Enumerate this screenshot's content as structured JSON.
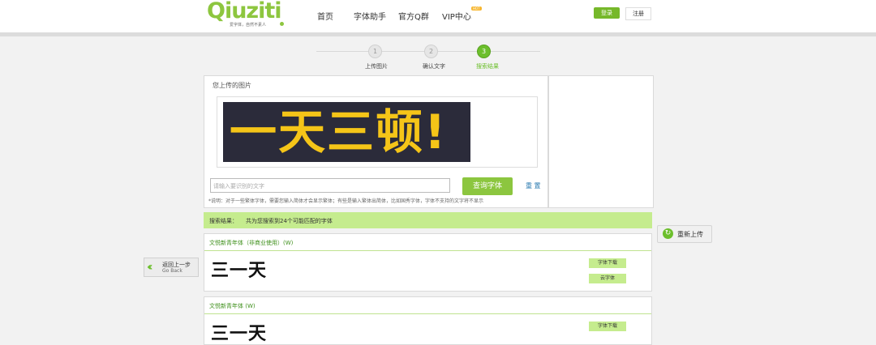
{
  "header": {
    "logo_text": "Qiuziti",
    "logo_slogan": "爱字体，自然不素人",
    "nav": [
      "首页",
      "字体助手",
      "官方Q群",
      "VIP中心"
    ],
    "vip_badge": "HOT",
    "login_label": "登录",
    "register_label": "注册"
  },
  "steps": [
    {
      "number": "1",
      "label": "上传图片"
    },
    {
      "number": "2",
      "label": "确认文字"
    },
    {
      "number": "3",
      "label": "搜索结果",
      "active": true
    }
  ],
  "upload": {
    "title": "您上传的图片",
    "preview_text": "一天三顿!",
    "search_placeholder": "请输入要识别的文字",
    "search_button": "查询字体",
    "reset_link": "重 置",
    "notice": "*说明：对于一些繁体字体，需要您输入简体才会显示繁体；有些是输入繁体出简体，比如国秀字体，字体不支持的文字将不显示"
  },
  "reupload_label": "重新上传",
  "back": {
    "cn": "返回上一步",
    "en": "Go Back"
  },
  "result": {
    "label": "搜索结果：",
    "count_text": "共为您搜索到24个可能匹配的字体"
  },
  "fonts": [
    {
      "name": "文悦新青年体（非商业使用）(W)",
      "sample": "三一天",
      "download": "字体下载",
      "cloud": "云字体"
    },
    {
      "name": "文悦新青年体 (W)",
      "sample": "三一天",
      "download": "字体下载"
    }
  ],
  "colors": {
    "accent": "#8dc63f",
    "result_bar": "#c5ec8e"
  },
  "icons": [
    "reload-icon",
    "double-chevron-left-icon"
  ]
}
